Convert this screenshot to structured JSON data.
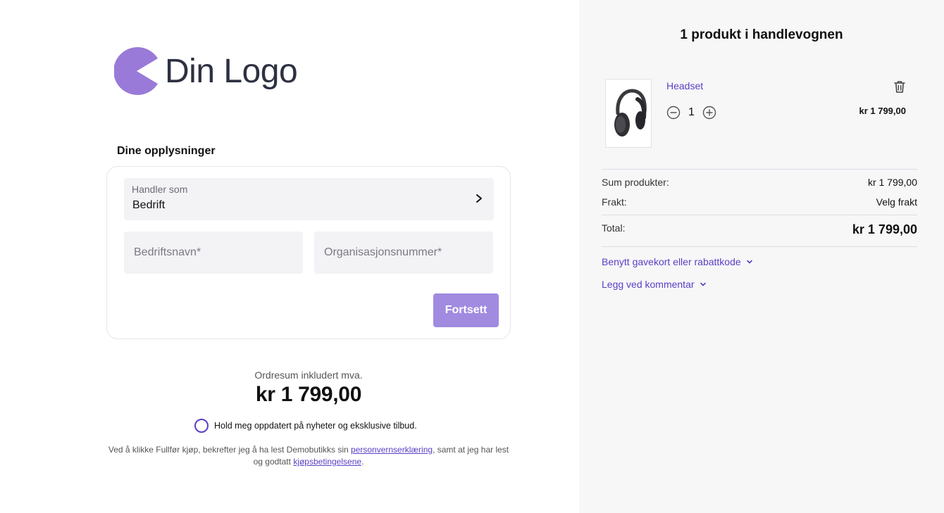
{
  "logo": {
    "text": "Din Logo",
    "color": "#9a7ad8"
  },
  "form": {
    "section_title": "Dine opplysninger",
    "trade_as": {
      "label": "Handler som",
      "value": "Bedrift"
    },
    "company_name_placeholder": "Bedriftsnavn*",
    "org_number_placeholder": "Organisasjonsnummer*",
    "continue_label": "Fortsett"
  },
  "summary": {
    "label": "Ordresum inkludert mva.",
    "value": "kr 1 799,00"
  },
  "newsletter": {
    "label": "Hold meg oppdatert på nyheter og eksklusive tilbud.",
    "checked": false
  },
  "terms": {
    "text_before": "Ved å klikke Fullfør kjøp, bekrefter jeg å ha lest Demobutikks sin ",
    "privacy_link": "personvernserklæring",
    "text_middle": ", samt at jeg har lest og godtatt ",
    "terms_link": "kjøpsbetingelsene",
    "text_after": "."
  },
  "cart": {
    "title": "1 produkt i handlevognen",
    "item": {
      "name": "Headset",
      "quantity": "1",
      "price": "kr 1 799,00",
      "icon": "headphones-image"
    },
    "sum_products_label": "Sum produkter:",
    "sum_products_value": "kr 1 799,00",
    "shipping_label": "Frakt:",
    "shipping_value": "Velg frakt",
    "total_label": "Total:",
    "total_value": "kr 1 799,00",
    "gift_card_link": "Benytt gavekort eller rabattkode",
    "comment_link": "Legg ved kommentar"
  },
  "colors": {
    "accent": "#5b3fc4",
    "button": "#a08be0",
    "panel_bg": "#f7f7f8",
    "field_bg": "#f3f3f6"
  }
}
